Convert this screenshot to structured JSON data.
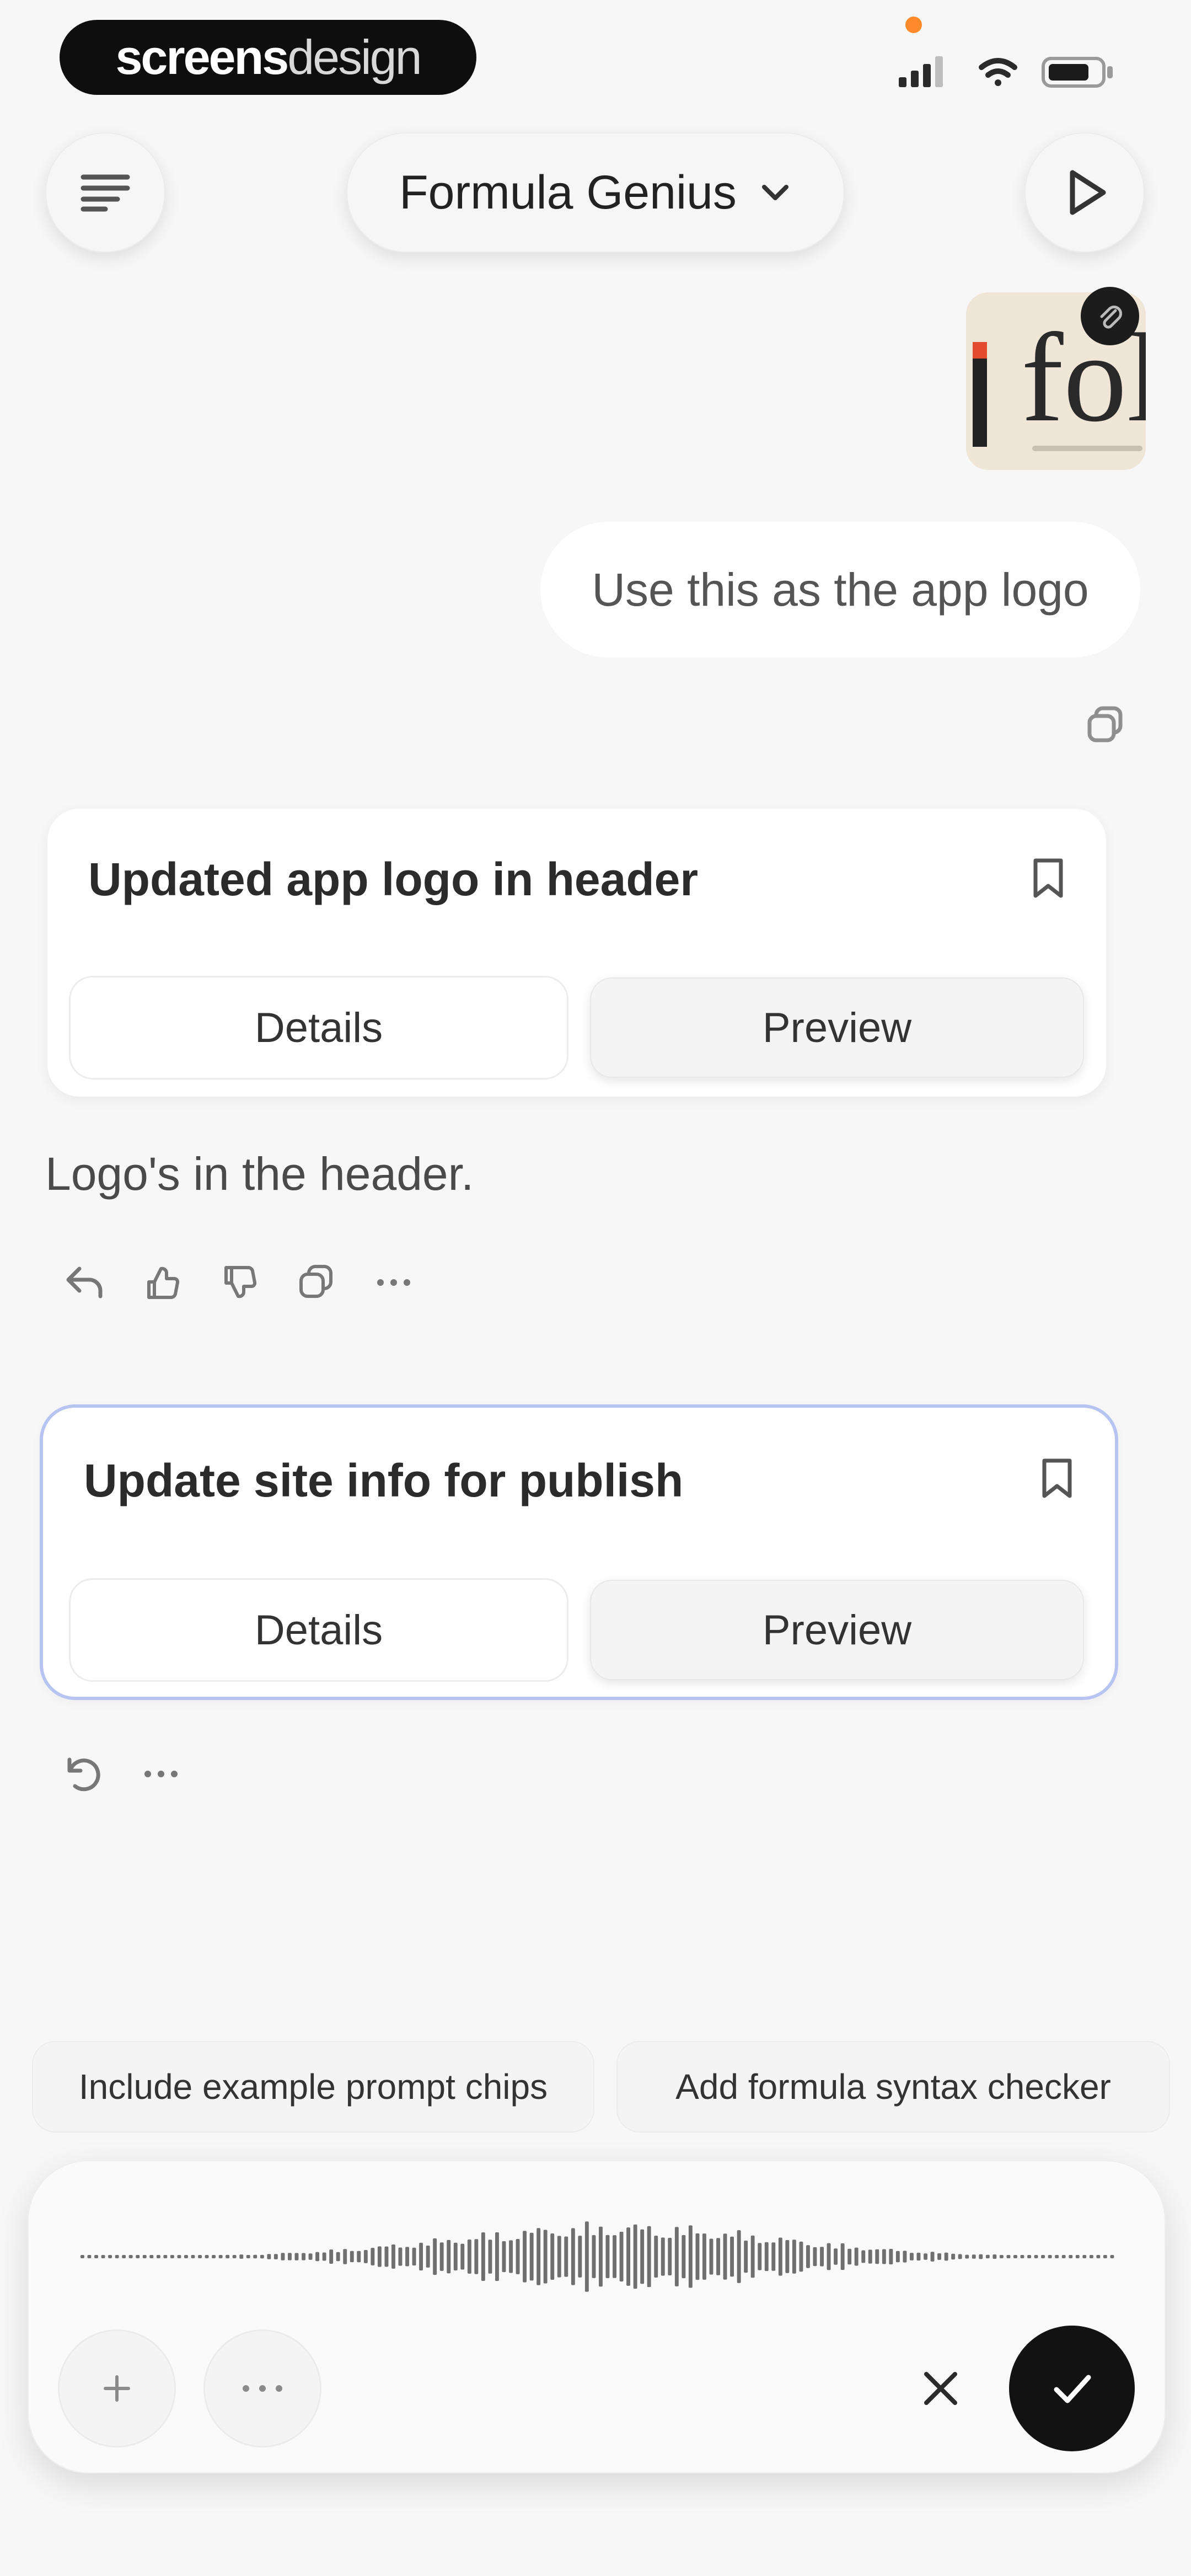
{
  "status_bar": {
    "brand_part1": "screens",
    "brand_part2": "design"
  },
  "header": {
    "model_name": "Formula Genius"
  },
  "conversation": {
    "user_message": "Use this as the app logo",
    "attachment_text": "fol",
    "card1": {
      "title": "Updated app logo in header",
      "details_label": "Details",
      "preview_label": "Preview"
    },
    "assistant_reply": "Logo's in the header.",
    "card2": {
      "title": "Update site info for publish",
      "details_label": "Details",
      "preview_label": "Preview"
    }
  },
  "suggestions": [
    "Include example prompt chips",
    "Add formula syntax checker"
  ],
  "composer": {
    "add_icon": "plus-icon",
    "more_icon": "more-icon",
    "cancel_icon": "close-icon",
    "confirm_icon": "check-icon"
  },
  "colors": {
    "accent_border": "#b7c4f2",
    "confirm": "#121212",
    "status_dot": "#ff8a2a"
  }
}
